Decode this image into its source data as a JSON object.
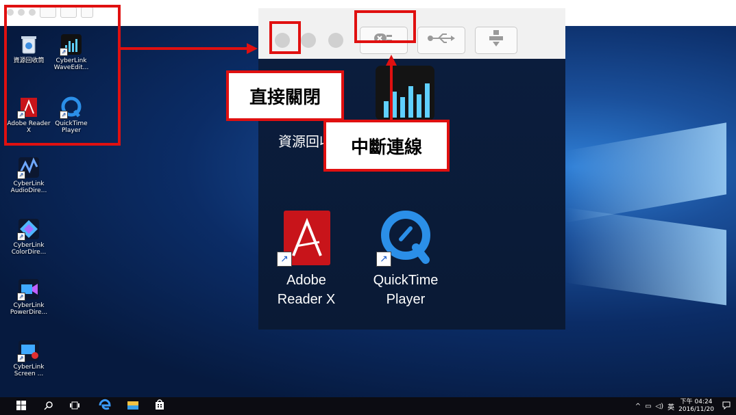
{
  "mini_toolbar": {
    "buttons": [
      "disconnect-icon",
      "usb-icon",
      "network-icon"
    ]
  },
  "desktop_icons": [
    {
      "label": "資源回收筒",
      "icon": "recycle-bin-icon"
    },
    {
      "label": "CyberLink WaveEdit...",
      "icon": "wave-editor-icon"
    },
    {
      "label": "Adobe Reader X",
      "icon": "adobe-reader-icon"
    },
    {
      "label": "QuickTime Player",
      "icon": "quicktime-icon"
    },
    {
      "label": "CyberLink AudioDire...",
      "icon": "audio-director-icon"
    },
    {
      "label": "CyberLink ColorDire...",
      "icon": "color-director-icon"
    },
    {
      "label": "CyberLink PowerDire...",
      "icon": "power-director-icon"
    },
    {
      "label": "CyberLink Screen ...",
      "icon": "screen-recorder-icon"
    }
  ],
  "zoom": {
    "recycle_label": "資源回收",
    "adobe_label_1": "Adobe",
    "adobe_label_2": "Reader X",
    "qt_label_1": "QuickTime",
    "qt_label_2": "Player"
  },
  "annotations": {
    "close_directly": "直接關閉",
    "disconnect": "中斷連線",
    "color": "#e01010"
  },
  "taskbar": {
    "time_period": "下午 04:24",
    "date": "2016/11/20",
    "ime": "英",
    "tray_icons": [
      "chevron-up-icon",
      "network-icon",
      "volume-icon"
    ]
  }
}
